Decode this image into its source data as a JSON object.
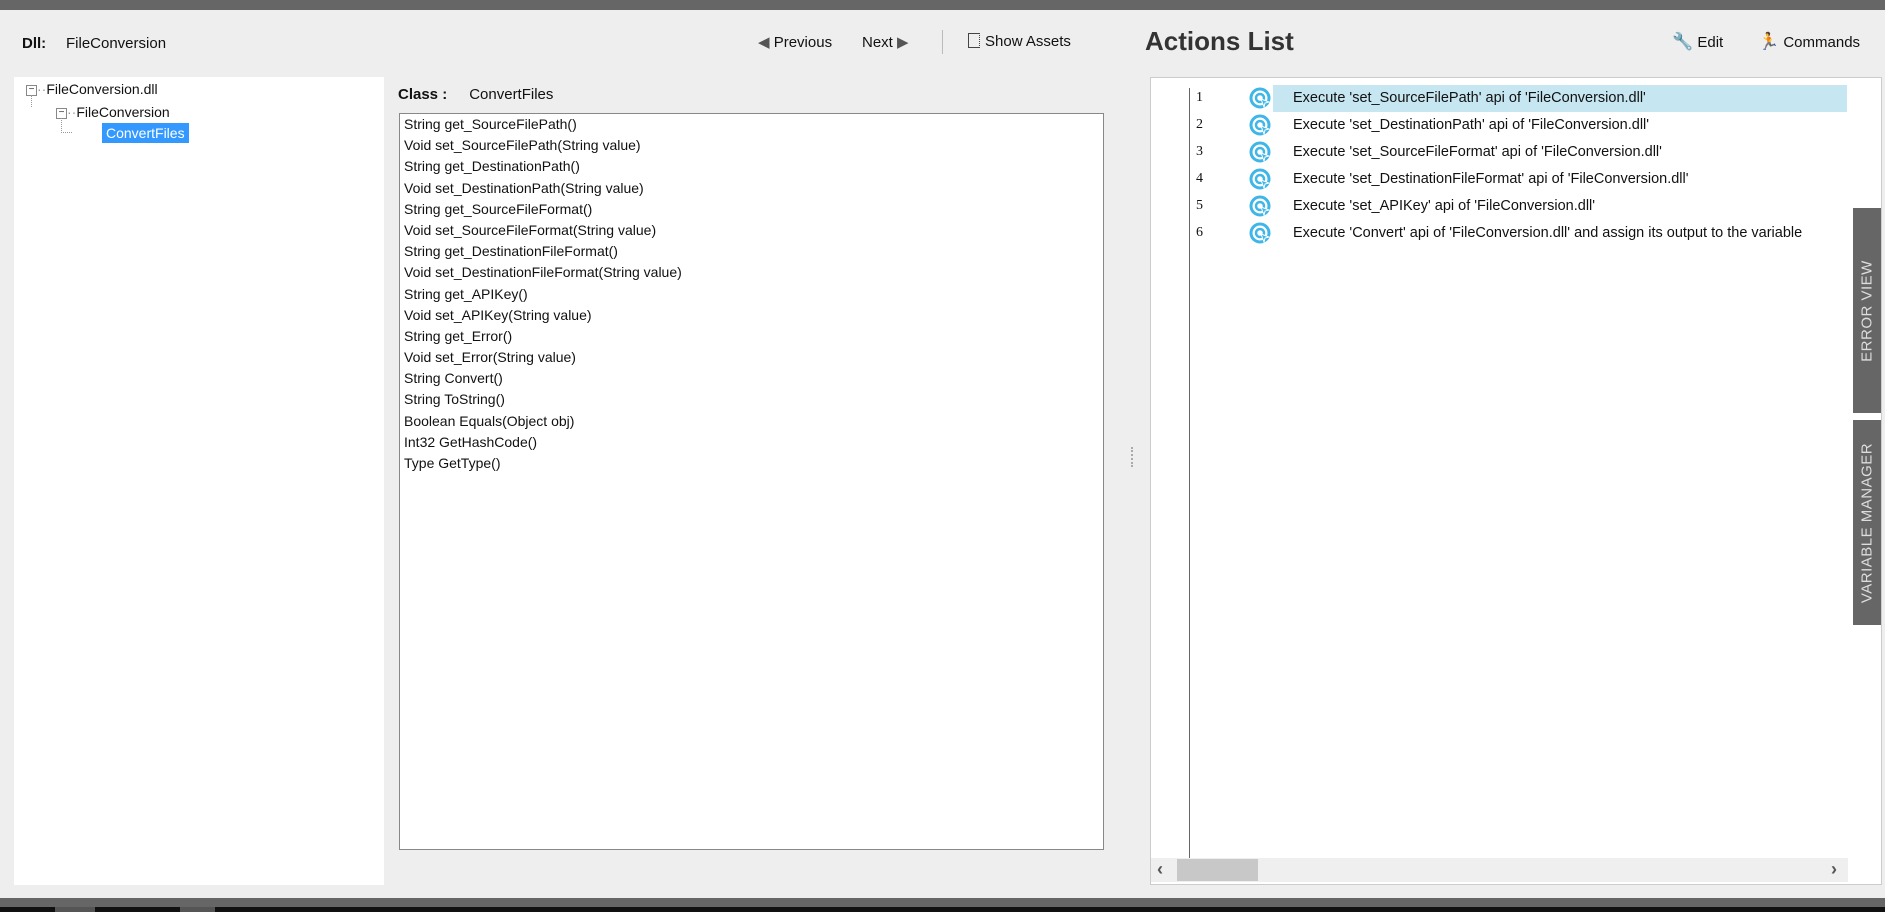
{
  "header": {
    "dll_label": "Dll:",
    "dll_value": "FileConversion",
    "previous": "Previous",
    "next": "Next",
    "show_assets": "Show Assets"
  },
  "tree": {
    "root": "FileConversion.dll",
    "namespace": "FileConversion",
    "class": "ConvertFiles"
  },
  "class_panel": {
    "label": "Class :",
    "value": "ConvertFiles",
    "methods": [
      "String get_SourceFilePath()",
      "Void set_SourceFilePath(String value)",
      "String get_DestinationPath()",
      "Void set_DestinationPath(String value)",
      "String get_SourceFileFormat()",
      "Void set_SourceFileFormat(String value)",
      "String get_DestinationFileFormat()",
      "Void set_DestinationFileFormat(String value)",
      "String get_APIKey()",
      "Void set_APIKey(String value)",
      "String get_Error()",
      "Void set_Error(String value)",
      "String Convert()",
      "String ToString()",
      "Boolean Equals(Object obj)",
      "Int32 GetHashCode()",
      "Type GetType()"
    ]
  },
  "actions": {
    "title": "Actions List",
    "edit": "Edit",
    "commands": "Commands",
    "items": [
      {
        "num": "1",
        "text": "Execute 'set_SourceFilePath' api of 'FileConversion.dll'"
      },
      {
        "num": "2",
        "text": "Execute 'set_DestinationPath' api of 'FileConversion.dll'"
      },
      {
        "num": "3",
        "text": "Execute 'set_SourceFileFormat' api of 'FileConversion.dll'"
      },
      {
        "num": "4",
        "text": "Execute 'set_DestinationFileFormat' api of 'FileConversion.dll'"
      },
      {
        "num": "5",
        "text": "Execute 'set_APIKey' api of 'FileConversion.dll'"
      },
      {
        "num": "6",
        "text": "Execute 'Convert' api of 'FileConversion.dll' and assign its output to the variable"
      }
    ]
  },
  "side_tabs": {
    "error_view": "ERROR VIEW",
    "variable_manager": "VARIABLE MANAGER"
  },
  "colors": {
    "selection": "#3399ff",
    "active_row": "#c6e6f1",
    "icon": "#3fb6e8",
    "tab_bg": "#666666"
  }
}
